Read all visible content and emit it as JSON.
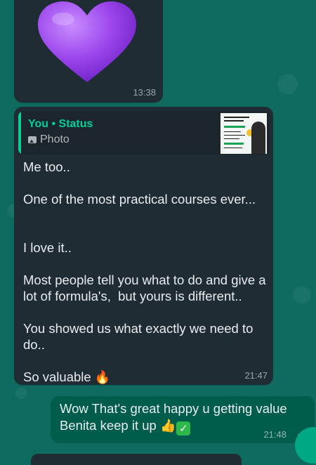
{
  "messages": {
    "heart": {
      "time": "13:38",
      "emoji_icon": "purple-heart-icon"
    },
    "main": {
      "quoted_author": "You • Status",
      "quoted_kind": "Photo",
      "text": "Me too..\n\nOne of the most practical courses ever...\n\n\nI love it..\n\nMost people tell you what to do and give a\nlot of formula's,  but yours is different..\n\nYou showed us what exactly we need to\ndo..\n\nSo valuable",
      "time": "21:47",
      "emoji_icon": "fire-icon"
    },
    "outgoing": {
      "text_line1": "Wow That's great happy u getting value",
      "text_line2": "Benita keep it up",
      "time": "21:48",
      "status_icon": "double-check-icon"
    }
  },
  "colors": {
    "background": "#0f6b5f",
    "incoming_bubble": "#1f2c34",
    "outgoing_bubble": "#005c4b",
    "accent": "#06cf9c"
  }
}
